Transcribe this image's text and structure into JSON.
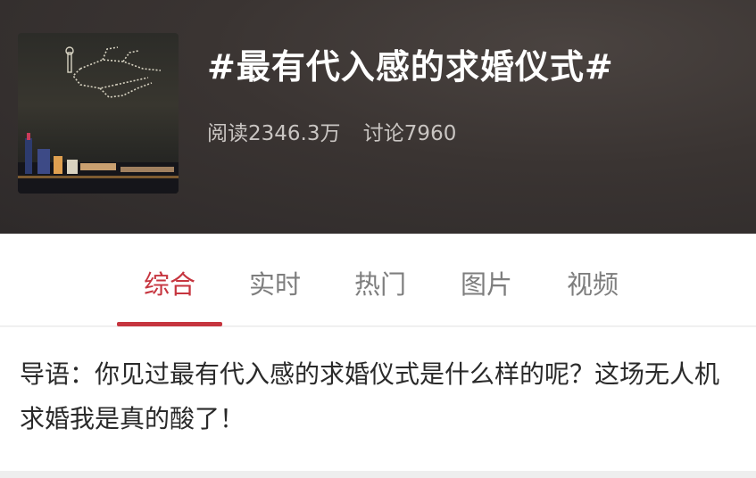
{
  "topic": {
    "title": "#最有代入感的求婚仪式#",
    "read_count": "阅读2346.3万",
    "discuss_count": "讨论7960"
  },
  "tabs": [
    {
      "label": "综合",
      "active": true
    },
    {
      "label": "实时",
      "active": false
    },
    {
      "label": "热门",
      "active": false
    },
    {
      "label": "图片",
      "active": false
    },
    {
      "label": "视频",
      "active": false
    }
  ],
  "intro": {
    "text": "导语：你见过最有代入感的求婚仪式是什么样的呢？这场无人机求婚我是真的酸了！"
  },
  "colors": {
    "accent": "#c6353f",
    "header_bg": "#3a3432"
  }
}
